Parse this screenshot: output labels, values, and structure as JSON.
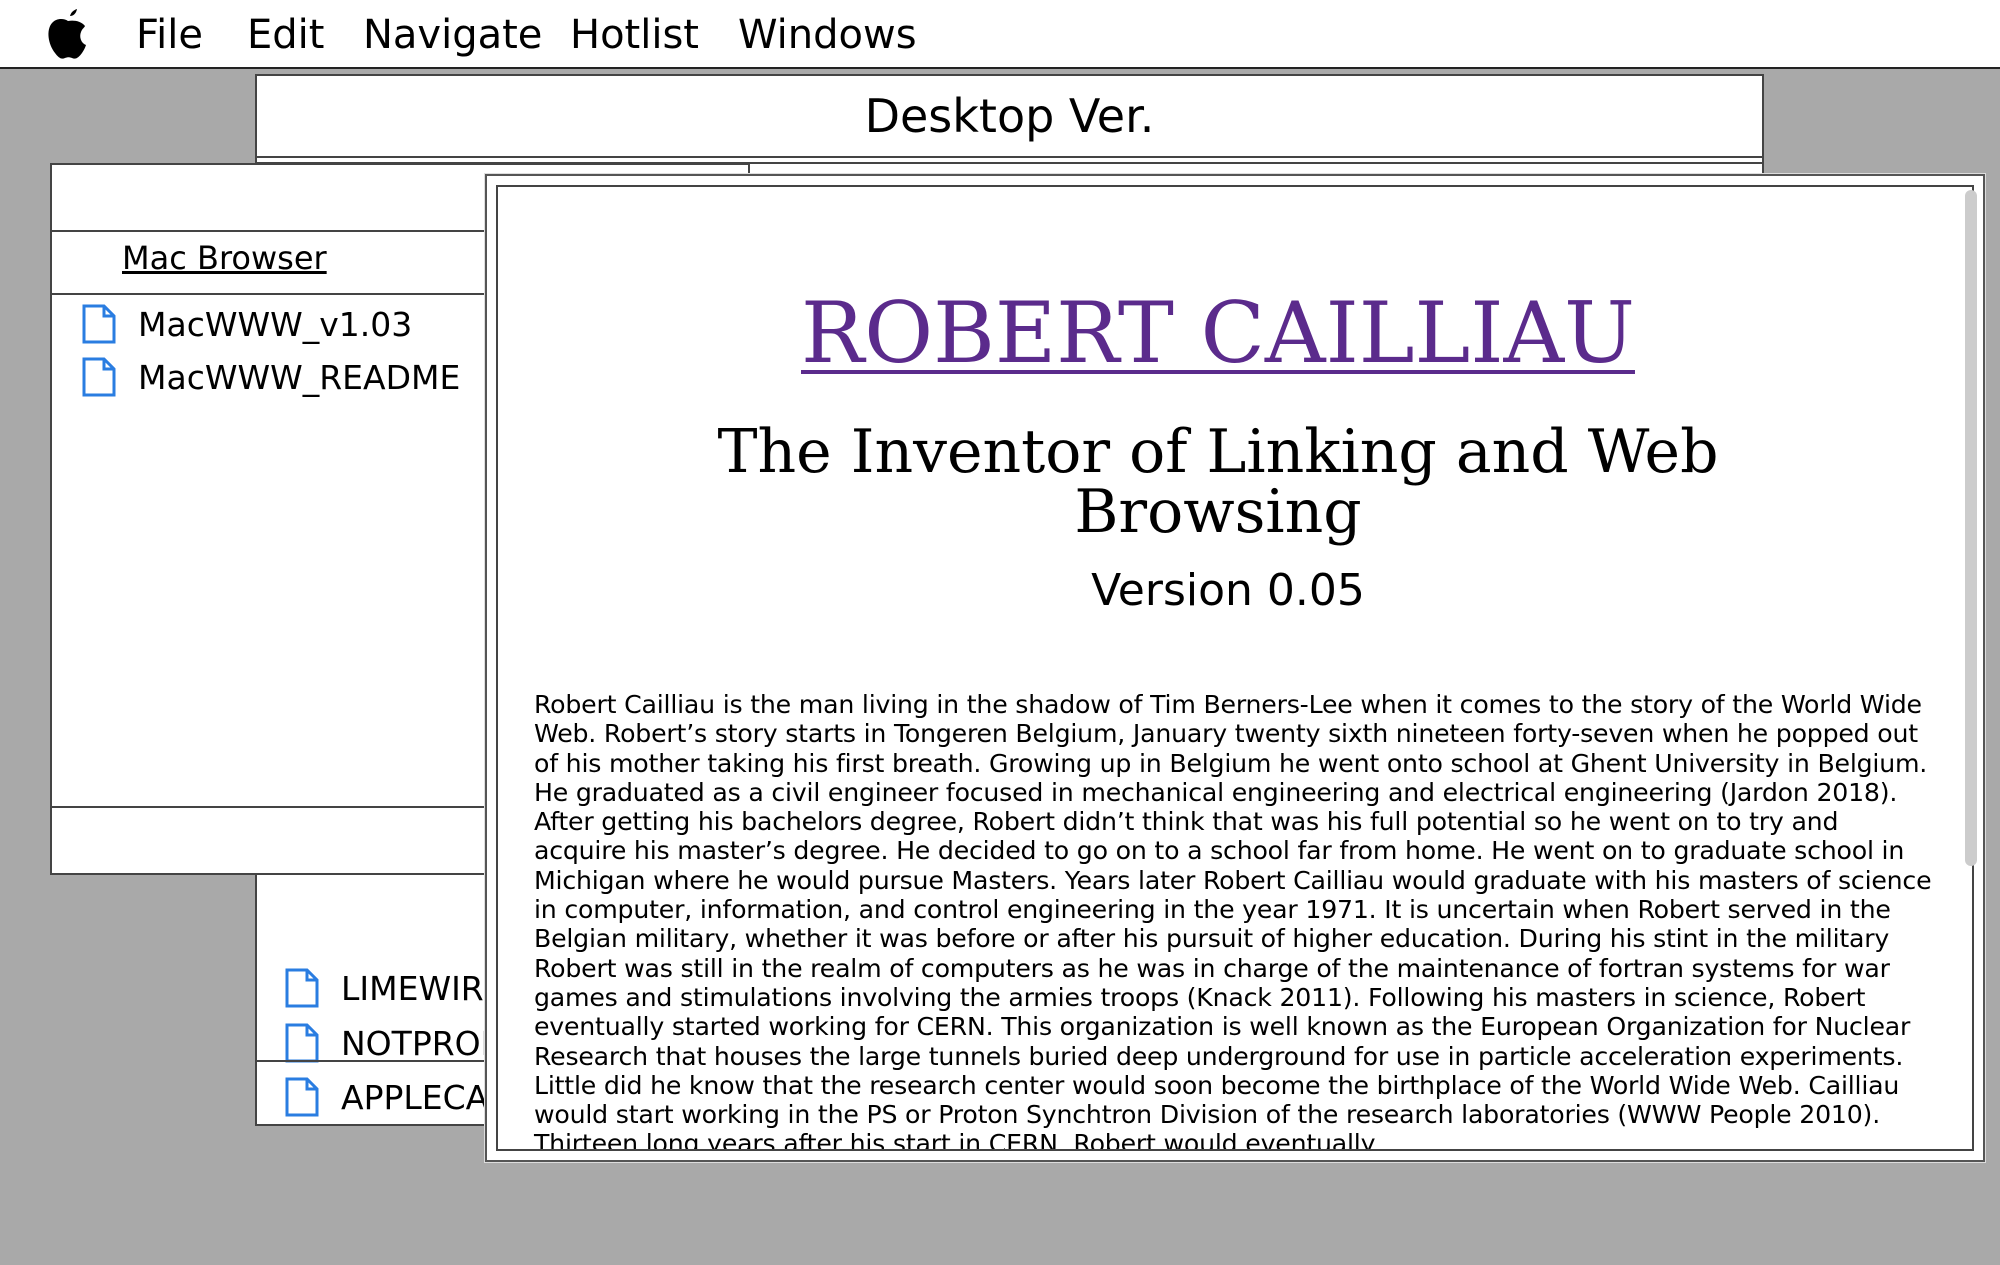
{
  "menubar": {
    "apple_icon": "apple-logo-icon",
    "items": [
      "File",
      "Edit",
      "Navigate",
      "Hotlist",
      "Windows"
    ]
  },
  "back_window": {
    "title": "Desktop Ver.",
    "files": [
      "LIMEWIRE",
      "NOTPRON",
      "APPLECAR"
    ]
  },
  "left_window": {
    "column_title": "Mac Browser",
    "files": [
      "MacWWW_v1.03",
      "MacWWW_README"
    ]
  },
  "front_window": {
    "headline": "ROBERT CAILLIAU",
    "subtitle": "The Inventor of Linking and Web Browsing",
    "version": "Version 0.05",
    "body": "Robert Cailliau is the man living in the shadow of Tim Berners-Lee when it comes to the story of the World Wide Web. Robert’s story starts in Tongeren Belgium, January twenty sixth nineteen forty-seven when he popped out of his mother taking his first breath. Growing up in Belgium he went onto school at Ghent University in Belgium. He graduated as a civil engineer focused in mechanical engineering and electrical engineering (Jardon 2018). After getting his bachelors degree, Robert didn’t think that was his full potential so he went on to try and acquire his master’s degree. He decided to go on to a school far from home. He went on to graduate school in Michigan where he would pursue Masters. Years later Robert Cailliau would graduate with his masters of science in computer, information, and control engineering in the year 1971. It is uncertain when Robert served in the Belgian military, whether it was before or after his pursuit of higher education. During his stint in the military Robert was still in the realm of computers as he was in charge of the maintenance of fortran systems for war games and stimulations involving the armies troops (Knack 2011). Following his masters in science, Robert eventually started working for CERN. This organization is well known as the European Organization for Nuclear Research that houses the large tunnels buried deep underground for use in particle acceleration experiments. Little did he know that the research center would soon become the birthplace of the World Wide Web. Cailliau would start working in the PS or Proton Synchtron Division of the research laboratories (WWW People 2010). Thirteen long years after his start in CERN, Robert would eventually"
  },
  "colors": {
    "desktop": "#a9a9a9",
    "headline": "#5b2b8c",
    "file_icon": "#2a7de1"
  }
}
